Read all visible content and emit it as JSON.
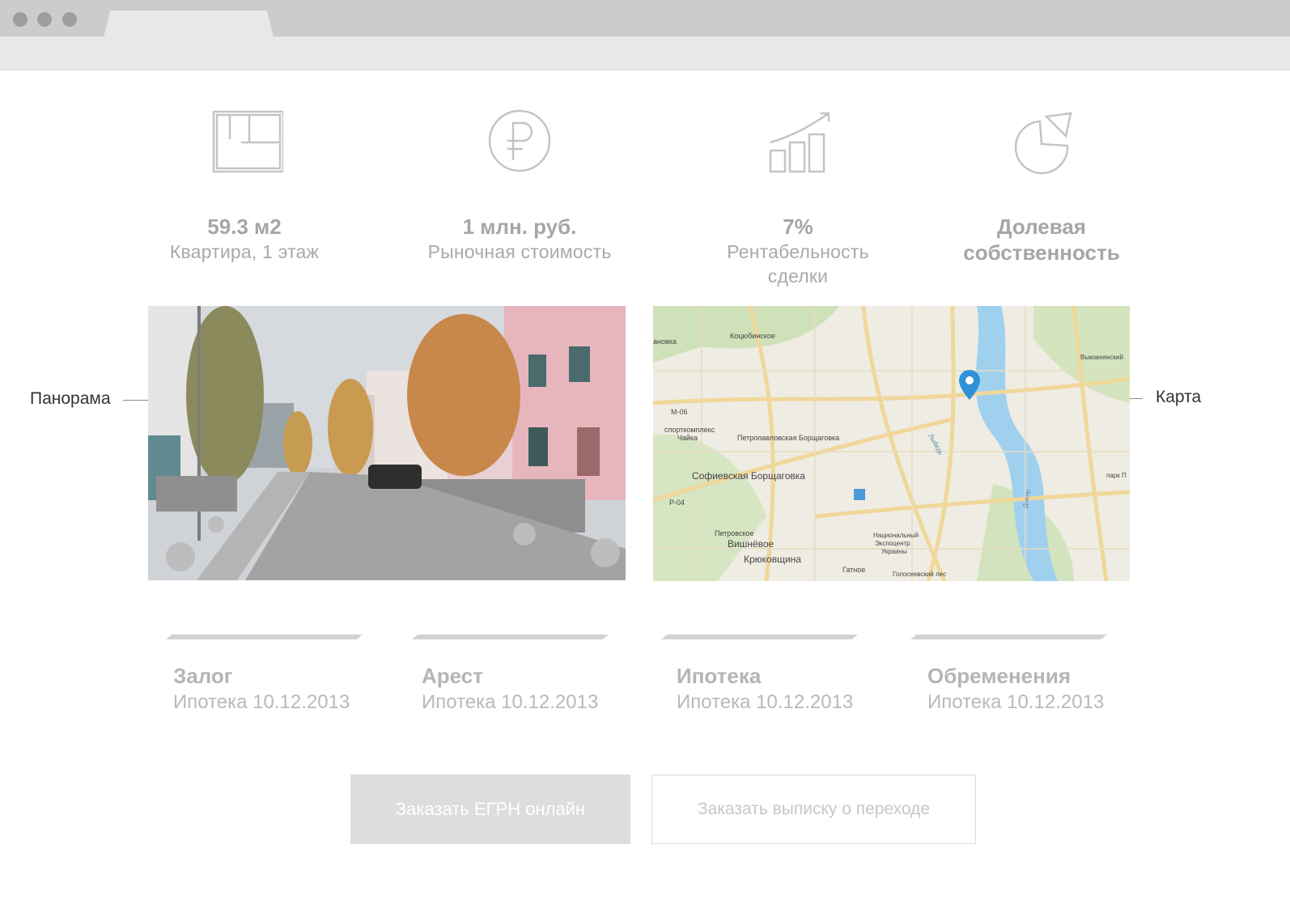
{
  "stats": [
    {
      "icon": "floor-plan-icon",
      "value": "59.3 м2",
      "label": "Квартира, 1 этаж"
    },
    {
      "icon": "ruble-icon",
      "value": "1 млн. руб.",
      "label": "Рыночная стоимость"
    },
    {
      "icon": "growth-chart-icon",
      "value": "7%",
      "label_line1": "Рентабельность",
      "label_line2": "сделки"
    },
    {
      "icon": "pie-chart-icon",
      "value_line1": "Долевая",
      "value_line2": "собственность"
    }
  ],
  "callouts": {
    "left": "Панорама",
    "right": "Карта"
  },
  "map": {
    "labels": [
      "Коцюбинское",
      "ановка",
      "M-06",
      "спорткомплекс",
      "Чайка",
      "Петропавловская Борщаговка",
      "Софиевская Борщаговка",
      "Р-04",
      "Петровское",
      "Вишнёвое",
      "Крюковщина",
      "Национальный",
      "Экспоцентр",
      "Украины",
      "Гатное",
      "Голосеевский лес",
      "Выковнянский",
      "парк П",
      "Днепр",
      "Лыбедь"
    ]
  },
  "statuses": [
    {
      "title": "Залог",
      "sub": "Ипотека 10.12.2013"
    },
    {
      "title": "Арест",
      "sub": "Ипотека 10.12.2013"
    },
    {
      "title": "Ипотека",
      "sub": "Ипотека 10.12.2013"
    },
    {
      "title": "Обременения",
      "sub": "Ипотека 10.12.2013"
    }
  ],
  "buttons": {
    "primary": "Заказать ЕГРН онлайн",
    "secondary": "Заказать выписку о переходе"
  },
  "colors": {
    "chrome": "#cccccc",
    "toolbar": "#e8e8e8",
    "muted_text": "#a9a9a9",
    "button_bg": "#dddddd",
    "map_pin": "#2f8fd8"
  }
}
